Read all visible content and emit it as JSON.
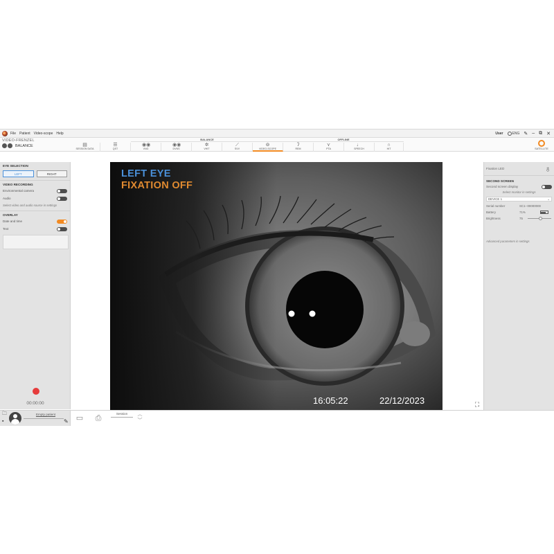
{
  "menubar": {
    "items": [
      "File",
      "Patient",
      "Video-scope",
      "Help"
    ],
    "user": "User",
    "language": "ENG"
  },
  "toolbar": {
    "mode_title": "VIDEO-FRENZEL",
    "mode_label": "BALANCE",
    "group_balance": "BALANCE",
    "group_offline": "OFFLINE",
    "tabs": [
      "SESSION DATA",
      "QST",
      "VNG",
      "DVNS",
      "VHIT",
      "SVV",
      "VIDEO-SCOPE",
      "REM",
      "PTA",
      "SPEECH",
      "HIT"
    ],
    "active_tab": "VIDEO-SCOPE",
    "satellite_label": "SATELLITE"
  },
  "left": {
    "eye_selection_title": "EYE SELECTION",
    "left_btn": "LEFT",
    "right_btn": "RIGHT",
    "video_recording_title": "VIDEO RECORDING",
    "env_camera": "Environmental camera",
    "audio": "Audio",
    "source_hint": "Select video and audio source in settings",
    "overlay_title": "OVERLAY",
    "date_time": "Date and time",
    "text": "Text",
    "timer": "00:00:00"
  },
  "video": {
    "eye_label": "LEFT EYE",
    "fixation_label": "FIXATION OFF",
    "time": "16:05:22",
    "date": "22/12/2023"
  },
  "right": {
    "fixation_led": "Fixation LED",
    "second_screen_title": "SECOND SCREEN",
    "second_screen_display": "Second screen display",
    "monitor_hint": "Select monitor in settings",
    "device": "DEVICE 1",
    "serial_label": "Serial number",
    "serial_value": "SC1--00000000",
    "battery_label": "Battery",
    "battery_value": "71%",
    "battery_level": 0.71,
    "brightness_label": "Brightness",
    "brightness_value": "75",
    "brightness_level": 0.55,
    "advanced_hint": "Advanced parameters in settings"
  },
  "bottom": {
    "patient": "Empty patient",
    "session": "Session"
  }
}
